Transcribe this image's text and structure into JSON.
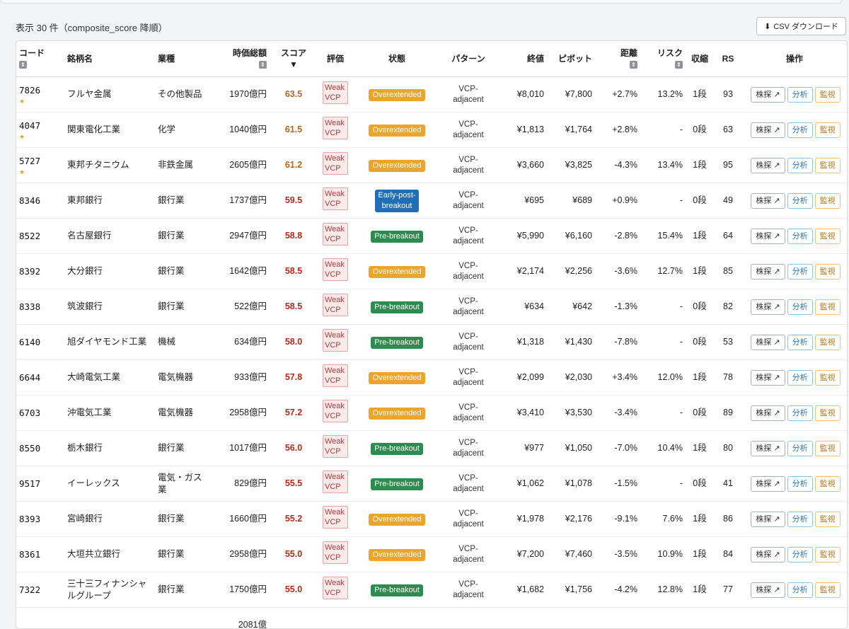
{
  "meta": {
    "count_label": "表示 30 件（composite_score 降順）",
    "csv_label": "CSV ダウンロード",
    "csv_icon": "download-icon"
  },
  "headers": {
    "code": "コード",
    "name": "銘柄名",
    "sector": "業種",
    "market_cap": "時価総額",
    "score": "スコア",
    "score_sort": "▼",
    "rating": "評価",
    "state": "状態",
    "pattern": "パターン",
    "close": "終値",
    "pivot": "ピボット",
    "distance": "距離",
    "risk": "リスク",
    "contraction": "収縮",
    "rs": "RS",
    "actions": "操作"
  },
  "actions": {
    "search_label": "株探",
    "search_icon": "external-link-icon",
    "analyze_label": "分析",
    "watch_label": "監視"
  },
  "colors": {
    "score_high": "#b5651d",
    "score_mid": "#b5291d",
    "overextended": "#eda42a",
    "pre_breakout": "#2f8a4f",
    "early_post_breakout": "#1f6fb8"
  },
  "rows": [
    {
      "code": "7826",
      "star": "★",
      "name": "フルヤ金属",
      "sector": "その他製品",
      "market_cap": "1970億円",
      "score": "63.5",
      "rating": "Weak VCP",
      "state": "Overextended",
      "state_kind": "over",
      "pattern": "VCP-adjacent",
      "close": "¥8,010",
      "pivot": "¥7,800",
      "distance": "+2.7%",
      "risk": "13.2%",
      "contraction": "1段",
      "rs": "93"
    },
    {
      "code": "4047",
      "star": "★",
      "name": "関東電化工業",
      "sector": "化学",
      "market_cap": "1040億円",
      "score": "61.5",
      "rating": "Weak VCP",
      "state": "Overextended",
      "state_kind": "over",
      "pattern": "VCP-adjacent",
      "close": "¥1,813",
      "pivot": "¥1,764",
      "distance": "+2.8%",
      "risk": "-",
      "contraction": "0段",
      "rs": "63"
    },
    {
      "code": "5727",
      "star": "★",
      "name": "東邦チタニウム",
      "sector": "非鉄金属",
      "market_cap": "2605億円",
      "score": "61.2",
      "rating": "Weak VCP",
      "state": "Overextended",
      "state_kind": "over",
      "pattern": "VCP-adjacent",
      "close": "¥3,660",
      "pivot": "¥3,825",
      "distance": "-4.3%",
      "risk": "13.4%",
      "contraction": "1段",
      "rs": "95"
    },
    {
      "code": "8346",
      "star": "",
      "name": "東邦銀行",
      "sector": "銀行業",
      "market_cap": "1737億円",
      "score": "59.5",
      "rating": "Weak VCP",
      "state": "Early-post-breakout",
      "state_kind": "early",
      "pattern": "VCP-adjacent",
      "close": "¥695",
      "pivot": "¥689",
      "distance": "+0.9%",
      "risk": "-",
      "contraction": "0段",
      "rs": "49"
    },
    {
      "code": "8522",
      "star": "",
      "name": "名古屋銀行",
      "sector": "銀行業",
      "market_cap": "2947億円",
      "score": "58.8",
      "rating": "Weak VCP",
      "state": "Pre-breakout",
      "state_kind": "pre",
      "pattern": "VCP-adjacent",
      "close": "¥5,990",
      "pivot": "¥6,160",
      "distance": "-2.8%",
      "risk": "15.4%",
      "contraction": "1段",
      "rs": "64"
    },
    {
      "code": "8392",
      "star": "",
      "name": "大分銀行",
      "sector": "銀行業",
      "market_cap": "1642億円",
      "score": "58.5",
      "rating": "Weak VCP",
      "state": "Overextended",
      "state_kind": "over",
      "pattern": "VCP-adjacent",
      "close": "¥2,174",
      "pivot": "¥2,256",
      "distance": "-3.6%",
      "risk": "12.7%",
      "contraction": "1段",
      "rs": "85"
    },
    {
      "code": "8338",
      "star": "",
      "name": "筑波銀行",
      "sector": "銀行業",
      "market_cap": "522億円",
      "score": "58.5",
      "rating": "Weak VCP",
      "state": "Pre-breakout",
      "state_kind": "pre",
      "pattern": "VCP-adjacent",
      "close": "¥634",
      "pivot": "¥642",
      "distance": "-1.3%",
      "risk": "-",
      "contraction": "0段",
      "rs": "82"
    },
    {
      "code": "6140",
      "star": "",
      "name": "旭ダイヤモンド工業",
      "sector": "機械",
      "market_cap": "634億円",
      "score": "58.0",
      "rating": "Weak VCP",
      "state": "Pre-breakout",
      "state_kind": "pre",
      "pattern": "VCP-adjacent",
      "close": "¥1,318",
      "pivot": "¥1,430",
      "distance": "-7.8%",
      "risk": "-",
      "contraction": "0段",
      "rs": "53"
    },
    {
      "code": "6644",
      "star": "",
      "name": "大崎電気工業",
      "sector": "電気機器",
      "market_cap": "933億円",
      "score": "57.8",
      "rating": "Weak VCP",
      "state": "Overextended",
      "state_kind": "over",
      "pattern": "VCP-adjacent",
      "close": "¥2,099",
      "pivot": "¥2,030",
      "distance": "+3.4%",
      "risk": "12.0%",
      "contraction": "1段",
      "rs": "78"
    },
    {
      "code": "6703",
      "star": "",
      "name": "沖電気工業",
      "sector": "電気機器",
      "market_cap": "2958億円",
      "score": "57.2",
      "rating": "Weak VCP",
      "state": "Overextended",
      "state_kind": "over",
      "pattern": "VCP-adjacent",
      "close": "¥3,410",
      "pivot": "¥3,530",
      "distance": "-3.4%",
      "risk": "-",
      "contraction": "0段",
      "rs": "89"
    },
    {
      "code": "8550",
      "star": "",
      "name": "栃木銀行",
      "sector": "銀行業",
      "market_cap": "1017億円",
      "score": "56.0",
      "rating": "Weak VCP",
      "state": "Pre-breakout",
      "state_kind": "pre",
      "pattern": "VCP-adjacent",
      "close": "¥977",
      "pivot": "¥1,050",
      "distance": "-7.0%",
      "risk": "10.4%",
      "contraction": "1段",
      "rs": "80"
    },
    {
      "code": "9517",
      "star": "",
      "name": "イーレックス",
      "sector": "電気・ガス業",
      "market_cap": "829億円",
      "score": "55.5",
      "rating": "Weak VCP",
      "state": "Pre-breakout",
      "state_kind": "pre",
      "pattern": "VCP-adjacent",
      "close": "¥1,062",
      "pivot": "¥1,078",
      "distance": "-1.5%",
      "risk": "-",
      "contraction": "0段",
      "rs": "41"
    },
    {
      "code": "8393",
      "star": "",
      "name": "宮崎銀行",
      "sector": "銀行業",
      "market_cap": "1660億円",
      "score": "55.2",
      "rating": "Weak VCP",
      "state": "Overextended",
      "state_kind": "over",
      "pattern": "VCP-adjacent",
      "close": "¥1,978",
      "pivot": "¥2,176",
      "distance": "-9.1%",
      "risk": "7.6%",
      "contraction": "1段",
      "rs": "86"
    },
    {
      "code": "8361",
      "star": "",
      "name": "大垣共立銀行",
      "sector": "銀行業",
      "market_cap": "2958億円",
      "score": "55.0",
      "rating": "Weak VCP",
      "state": "Overextended",
      "state_kind": "over",
      "pattern": "VCP-adjacent",
      "close": "¥7,200",
      "pivot": "¥7,460",
      "distance": "-3.5%",
      "risk": "10.9%",
      "contraction": "1段",
      "rs": "84"
    },
    {
      "code": "7322",
      "star": "",
      "name": "三十三フィナンシャルグループ",
      "sector": "銀行業",
      "market_cap": "1750億円",
      "score": "55.0",
      "rating": "Weak VCP",
      "state": "Pre-breakout",
      "state_kind": "pre",
      "pattern": "VCP-adjacent",
      "close": "¥1,682",
      "pivot": "¥1,756",
      "distance": "-4.2%",
      "risk": "12.8%",
      "contraction": "1段",
      "rs": "77"
    },
    {
      "code": "",
      "star": "",
      "name": "",
      "sector": "",
      "market_cap": "2081億",
      "score": "",
      "rating": "",
      "state": "",
      "state_kind": "",
      "pattern": "",
      "close": "",
      "pivot": "",
      "distance": "",
      "risk": "",
      "contraction": "",
      "rs": ""
    }
  ]
}
